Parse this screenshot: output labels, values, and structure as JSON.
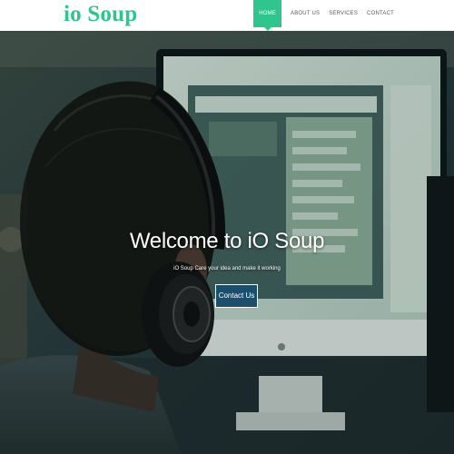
{
  "brand": {
    "name": "io Soup"
  },
  "nav": {
    "items": [
      {
        "label": "HOME",
        "active": true
      },
      {
        "label": "ABOUT US",
        "active": false
      },
      {
        "label": "SERVICES",
        "active": false
      },
      {
        "label": "CONTACT",
        "active": false
      }
    ]
  },
  "hero": {
    "title": "Welcome to iO Soup",
    "subtitle": "iO Soup Care your idea and make it working",
    "cta_label": "Contact Us"
  },
  "colors": {
    "accent": "#2fc58c",
    "cta_bg": "#1d4e6c",
    "nav_text": "#5a5a5a"
  }
}
